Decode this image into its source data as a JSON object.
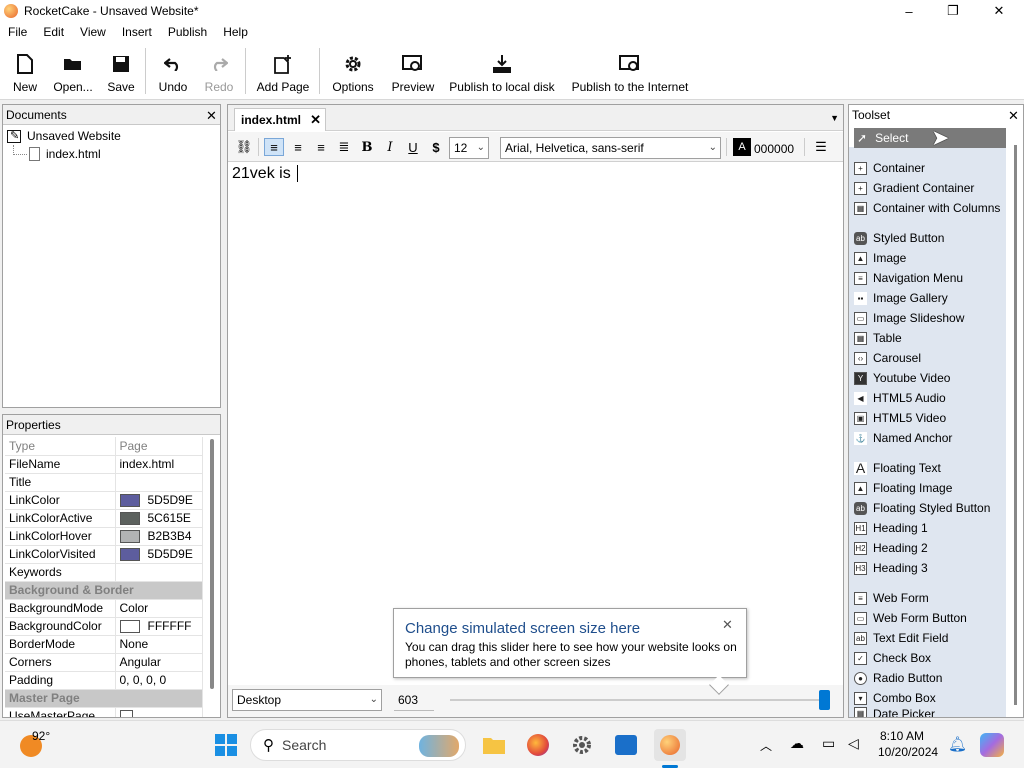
{
  "window": {
    "title": "RocketCake - Unsaved Website*",
    "minimize": "–",
    "maximize": "❐",
    "close": "✕"
  },
  "menu": [
    "File",
    "Edit",
    "View",
    "Insert",
    "Publish",
    "Help"
  ],
  "toolbar": {
    "new": "New",
    "open": "Open...",
    "save": "Save",
    "undo": "Undo",
    "redo": "Redo",
    "add_page": "Add Page",
    "options": "Options",
    "preview": "Preview",
    "publish_local": "Publish to local disk",
    "publish_internet": "Publish to the Internet"
  },
  "documents": {
    "title": "Documents",
    "website": "Unsaved Website",
    "page": "index.html"
  },
  "properties": {
    "title": "Properties",
    "header": {
      "key": "Type",
      "value": "Page"
    },
    "rows": [
      {
        "key": "FileName",
        "value": "index.html"
      },
      {
        "key": "Title",
        "value": ""
      },
      {
        "key": "LinkColor",
        "value": "5D5D9E",
        "color": "#5D5D9E"
      },
      {
        "key": "LinkColorActive",
        "value": "5C615E",
        "color": "#5C615E"
      },
      {
        "key": "LinkColorHover",
        "value": "B2B3B4",
        "color": "#B2B3B4"
      },
      {
        "key": "LinkColorVisited",
        "value": "5D5D9E",
        "color": "#5D5D9E"
      },
      {
        "key": "Keywords",
        "value": ""
      }
    ],
    "section_bg": "Background & Border",
    "rows2": [
      {
        "key": "BackgroundMode",
        "value": "Color"
      },
      {
        "key": "BackgroundColor",
        "value": "FFFFFF",
        "color": "#FFFFFF"
      },
      {
        "key": "BorderMode",
        "value": "None"
      },
      {
        "key": "Corners",
        "value": "Angular"
      },
      {
        "key": "Padding",
        "value": "0, 0, 0, 0"
      }
    ],
    "section_master": "Master Page",
    "rows3": [
      {
        "key": "UseMasterPage",
        "value": ""
      }
    ]
  },
  "editor": {
    "tab": "index.html",
    "font_size": "12",
    "font_family": "Arial, Helvetica, sans-serif",
    "color_value": "000000",
    "content": "21vek is ",
    "screen_mode": "Desktop",
    "screen_width": "603"
  },
  "tooltip": {
    "title": "Change simulated screen size here",
    "body": "You can drag this slider here to see how your website looks on phones, tablets and other screen sizes"
  },
  "toolset": {
    "title": "Toolset",
    "items": [
      [
        "Select"
      ],
      [
        "Container",
        "Gradient Container",
        "Container with Columns"
      ],
      [
        "Styled Button",
        "Image",
        "Navigation Menu",
        "Image Gallery",
        "Image Slideshow",
        "Table",
        "Carousel",
        "Youtube Video",
        "HTML5 Audio",
        "HTML5 Video",
        "Named Anchor"
      ],
      [
        "Floating Text",
        "Floating Image",
        "Floating Styled Button",
        "Heading 1",
        "Heading 2",
        "Heading 3"
      ],
      [
        "Web Form",
        "Web Form Button",
        "Text Edit Field",
        "Check Box",
        "Radio Button",
        "Combo Box",
        "Date Picker"
      ]
    ]
  },
  "taskbar": {
    "weather": "92°",
    "search": "Search",
    "time": "8:10 AM",
    "date": "10/20/2024"
  },
  "colors": {
    "accent": "#0078d4",
    "select_bg": "#7a7a7a",
    "toolset_bg": "#dfe6f0"
  }
}
